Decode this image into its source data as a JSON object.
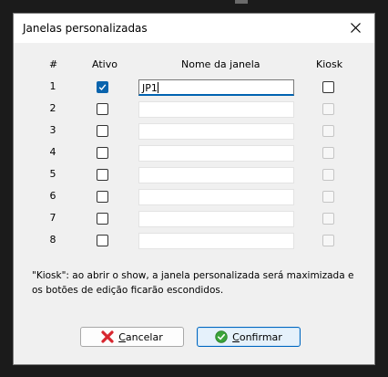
{
  "dialog": {
    "title": "Janelas personalizadas"
  },
  "table": {
    "headers": {
      "number": "#",
      "active": "Ativo",
      "name": "Nome da janela",
      "kiosk": "Kiosk"
    },
    "rows": [
      {
        "number": "1",
        "active": true,
        "name": "JP1",
        "kiosk": false,
        "kiosk_enabled": true
      },
      {
        "number": "2",
        "active": false,
        "name": "",
        "kiosk": false,
        "kiosk_enabled": false
      },
      {
        "number": "3",
        "active": false,
        "name": "",
        "kiosk": false,
        "kiosk_enabled": false
      },
      {
        "number": "4",
        "active": false,
        "name": "",
        "kiosk": false,
        "kiosk_enabled": false
      },
      {
        "number": "5",
        "active": false,
        "name": "",
        "kiosk": false,
        "kiosk_enabled": false
      },
      {
        "number": "6",
        "active": false,
        "name": "",
        "kiosk": false,
        "kiosk_enabled": false
      },
      {
        "number": "7",
        "active": false,
        "name": "",
        "kiosk": false,
        "kiosk_enabled": false
      },
      {
        "number": "8",
        "active": false,
        "name": "",
        "kiosk": false,
        "kiosk_enabled": false
      }
    ]
  },
  "note": "\"Kiosk\": ao abrir o show, a janela personalizada será maximizada e os botões de edição ficarão escondidos.",
  "buttons": {
    "cancel": {
      "mnemonic": "C",
      "rest": "ancelar",
      "icon": "red-x-icon"
    },
    "confirm": {
      "mnemonic": "C",
      "rest": "onfirmar",
      "icon": "green-check-icon"
    }
  },
  "colors": {
    "accent": "#0063b1",
    "checked": "#0a64ad",
    "cancel_icon": "#d7262f",
    "confirm_icon": "#3aa43a"
  }
}
